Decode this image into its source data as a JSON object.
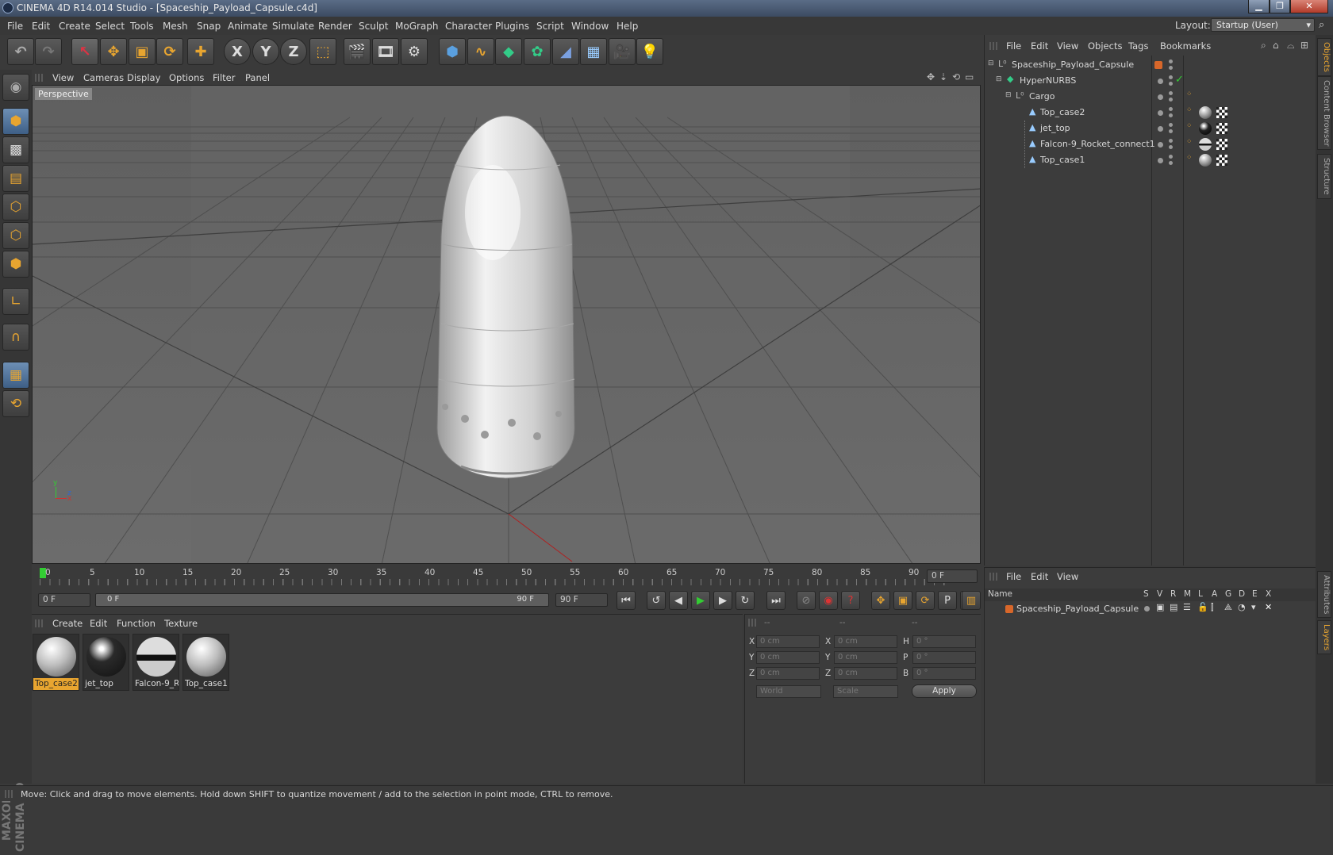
{
  "window": {
    "title": "CINEMA 4D R14.014 Studio - [Spaceship_Payload_Capsule.c4d]",
    "min_glyph": "▁",
    "max_glyph": "❐",
    "close_glyph": "✕"
  },
  "menu": {
    "items": [
      "File",
      "Edit",
      "Create",
      "Select",
      "Tools",
      "Mesh",
      "Snap",
      "Animate",
      "Simulate",
      "Render",
      "Sculpt",
      "MoGraph",
      "Character",
      "Plugins",
      "Script",
      "Window",
      "Help"
    ],
    "layout_label": "Layout:",
    "layout_value": "Startup (User)"
  },
  "toolbar": {
    "axis_x": "X",
    "axis_y": "Y",
    "axis_z": "Z"
  },
  "viewport": {
    "menu": [
      "View",
      "Cameras",
      "Display",
      "Options",
      "Filter",
      "Panel"
    ],
    "label": "Perspective",
    "axis_y": "y",
    "axis_z": "z",
    "axis_x": "x"
  },
  "timeline": {
    "ticks": [
      "0",
      "5",
      "10",
      "15",
      "20",
      "25",
      "30",
      "35",
      "40",
      "45",
      "50",
      "55",
      "60",
      "65",
      "70",
      "75",
      "80",
      "85",
      "90"
    ],
    "frame_field": "0 F",
    "current_field": "0 F",
    "range_start": "0 F",
    "range_end": "90 F",
    "end_field": "90 F"
  },
  "materials": {
    "menu": [
      "Create",
      "Edit",
      "Function",
      "Texture"
    ],
    "items": [
      {
        "label": "Top_case2",
        "selected": true
      },
      {
        "label": "jet_top",
        "selected": false
      },
      {
        "label": "Falcon-9_R",
        "selected": false
      },
      {
        "label": "Top_case1",
        "selected": false
      }
    ]
  },
  "coords": {
    "header": [
      "--",
      "--",
      "--"
    ],
    "rows": [
      {
        "l1": "X",
        "v1": "0 cm",
        "l2": "X",
        "v2": "0 cm",
        "l3": "H",
        "v3": "0 °"
      },
      {
        "l1": "Y",
        "v1": "0 cm",
        "l2": "Y",
        "v2": "0 cm",
        "l3": "P",
        "v3": "0 °"
      },
      {
        "l1": "Z",
        "v1": "0 cm",
        "l2": "Z",
        "v2": "0 cm",
        "l3": "B",
        "v3": "0 °"
      }
    ],
    "world": "World",
    "scale": "Scale",
    "apply": "Apply"
  },
  "objects": {
    "menu": [
      "File",
      "Edit",
      "View",
      "Objects",
      "Tags",
      "Bookmarks"
    ],
    "tree": [
      {
        "name": "Spaceship_Payload_Capsule",
        "depth": 0
      },
      {
        "name": "HyperNURBS",
        "depth": 1
      },
      {
        "name": "Cargo",
        "depth": 2
      },
      {
        "name": "Top_case2",
        "depth": 3
      },
      {
        "name": "jet_top",
        "depth": 3
      },
      {
        "name": "Falcon-9_Rocket_connect1",
        "depth": 3
      },
      {
        "name": "Top_case1",
        "depth": 3
      }
    ]
  },
  "layers": {
    "menu": [
      "File",
      "Edit",
      "View"
    ],
    "columns": [
      "Name",
      "S",
      "V",
      "R",
      "M",
      "L",
      "A",
      "G",
      "D",
      "E",
      "X"
    ],
    "rows": [
      {
        "name": "Spaceship_Payload_Capsule"
      }
    ]
  },
  "side_tabs": [
    "Objects",
    "Content Browser",
    "Structure",
    "Attributes",
    "Layers"
  ],
  "status": "Move: Click and drag to move elements. Hold down SHIFT to quantize movement / add to the selection in point mode, CTRL to remove.",
  "brand": "MAXON CINEMA 4D",
  "colors": {
    "accent": "#e8a530",
    "selected_blue": "#3e5f86",
    "layer_orange": "#d8672a"
  }
}
